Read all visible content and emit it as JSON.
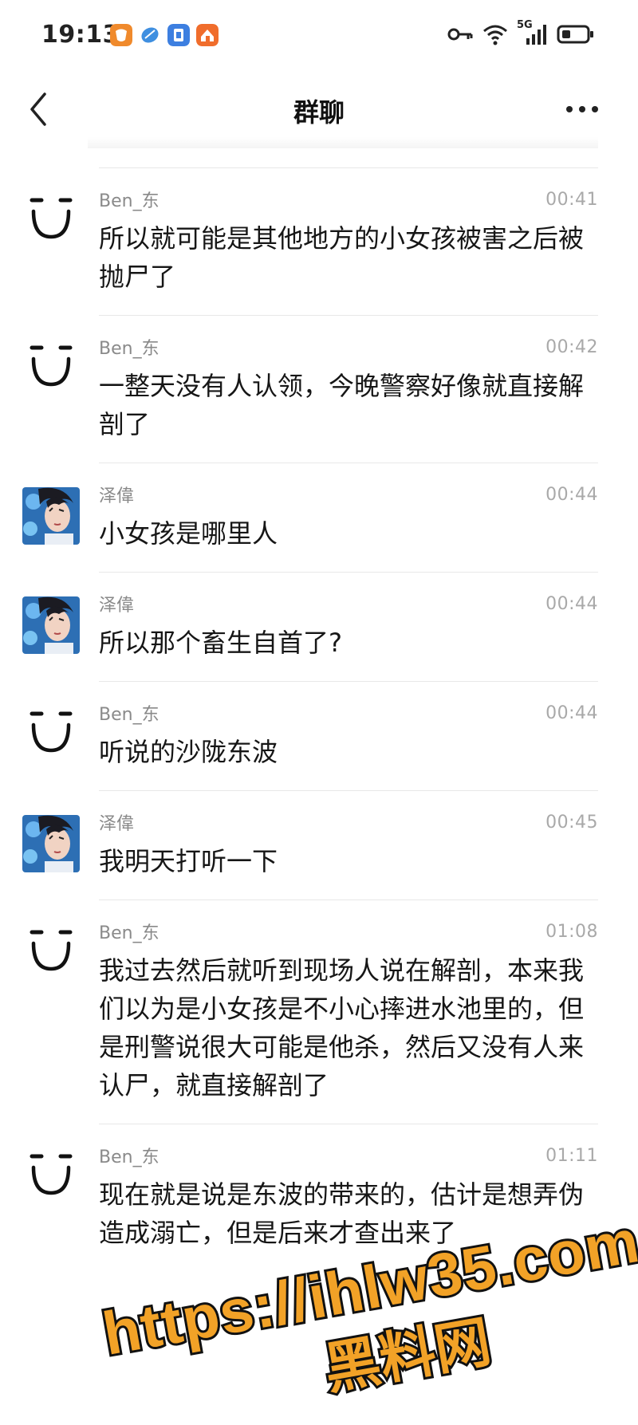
{
  "status_bar": {
    "time": "19:13",
    "network": "5G"
  },
  "header": {
    "title": "群聊"
  },
  "messages": [
    {
      "name": "Ben_东",
      "time": "00:41",
      "text": "所以就可能是其他地方的小女孩被害之后被抛尸了",
      "avatar": "face-icon"
    },
    {
      "name": "Ben_东",
      "time": "00:42",
      "text": "一整天没有人认领，今晚警察好像就直接解剖了",
      "avatar": "face-icon"
    },
    {
      "name": "泽偉",
      "time": "00:44",
      "text": "小女孩是哪里人",
      "avatar": "photo"
    },
    {
      "name": "泽偉",
      "time": "00:44",
      "text": "所以那个畜生自首了?",
      "avatar": "photo"
    },
    {
      "name": "Ben_东",
      "time": "00:44",
      "text": "听说的沙陇东波",
      "avatar": "face-icon"
    },
    {
      "name": "泽偉",
      "time": "00:45",
      "text": "我明天打听一下",
      "avatar": "photo"
    },
    {
      "name": "Ben_东",
      "time": "01:08",
      "text": "我过去然后就听到现场人说在解剖，本来我们以为是小女孩是不小心摔进水池里的，但是刑警说很大可能是他杀，然后又没有人来认尸，就直接解剖了",
      "avatar": "face-icon"
    },
    {
      "name": "Ben_东",
      "time": "01:11",
      "text": "现在就是说是东波的带来的，估计是想弄伪造成溺亡，但是后来才查出来了",
      "avatar": "face-icon"
    }
  ],
  "watermark": {
    "url": "https://ihlw35.com",
    "name": "黑料网",
    "fill": "#f2a227",
    "stroke": "#111111"
  }
}
